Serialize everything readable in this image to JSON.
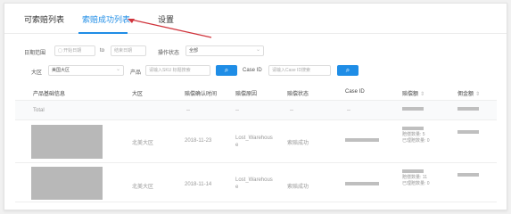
{
  "tabs": [
    "可索赔列表",
    "索赔成功列表",
    "设置"
  ],
  "filters": {
    "date_label": "日期范围",
    "date_start_placeholder": "开始日期",
    "date_to": "to",
    "date_end_placeholder": "结束日期",
    "status_label": "操作状态",
    "status_value": "全部",
    "region_label": "大区",
    "region_value": "美国大区",
    "product_label": "产品",
    "product_placeholder": "请输入SKU 标题搜索",
    "caseid_label": "Case ID",
    "caseid_placeholder": "请输入Case ID搜索",
    "query_icon": "search-icon"
  },
  "table": {
    "headers": [
      "产品基础信息",
      "大区",
      "赔偿确认时间",
      "赔偿原因",
      "赔偿状态",
      "Case ID",
      "赔偿额",
      "佣金额"
    ],
    "total_row": {
      "label": "Total",
      "dash": "--"
    },
    "rows": [
      {
        "region": "北美大区",
        "date": "2018-11-23",
        "reason": "Lost_Warehouse",
        "status": "索赔成功",
        "detail_count": "赔偿数量: 5",
        "detail_qty": "已理赔数量: 0"
      },
      {
        "region": "北美大区",
        "date": "2018-11-14",
        "reason": "Lost_Warehouse",
        "status": "索赔成功",
        "detail_count": "赔偿数量: 11",
        "detail_qty": "已理赔数量: 0"
      }
    ]
  },
  "colors": {
    "accent": "#1f8de6",
    "arrow": "#d0343c"
  }
}
